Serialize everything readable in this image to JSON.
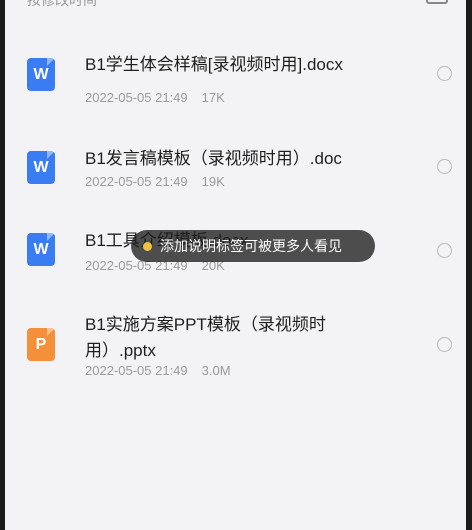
{
  "sort": {
    "label": "按修改时间"
  },
  "files": [
    {
      "name": "B1学生体会样稿[录视频时用].docx",
      "date": "2022-05-05 21:49",
      "size": "17K",
      "type": "word",
      "icon_letter": "W"
    },
    {
      "name": "B1发言稿模板（录视频时用）.doc",
      "date": "2022-05-05 21:49",
      "size": "19K",
      "type": "word",
      "icon_letter": "W"
    },
    {
      "name": "B1工具介绍模板.docx",
      "date": "2022-05-05 21:49",
      "size": "20K",
      "type": "word",
      "icon_letter": "W"
    },
    {
      "name": "B1实施方案PPT模板（录视频时用）.pptx",
      "date": "2022-05-05 21:49",
      "size": "3.0M",
      "type": "ppt",
      "icon_letter": "P"
    }
  ],
  "toast": {
    "text": "添加说明标签可被更多人看见"
  },
  "colors": {
    "word_icon": "#3a7cf1",
    "ppt_icon": "#f48f3a",
    "toast_dot": "#f3c23c"
  }
}
